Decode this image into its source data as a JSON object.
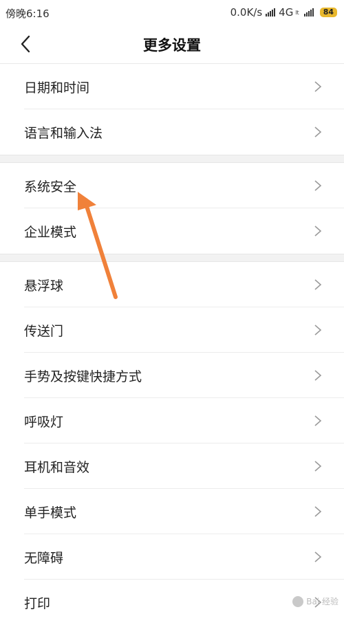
{
  "status_bar": {
    "time": "傍晚6:16",
    "net_speed": "0.0K/s",
    "network": "4G",
    "network_sub": "lt",
    "battery": "84"
  },
  "header": {
    "title": "更多设置"
  },
  "groups": [
    {
      "items": [
        "日期和时间",
        "语言和输入法"
      ]
    },
    {
      "items": [
        "系统安全",
        "企业模式"
      ]
    },
    {
      "items": [
        "悬浮球",
        "传送门",
        "手势及按键快捷方式",
        "呼吸灯",
        "耳机和音效",
        "单手模式",
        "无障碍",
        "打印"
      ]
    }
  ],
  "annotation": {
    "color": "#f0813a",
    "target": "系统安全"
  },
  "watermark": {
    "text": "Bai 经验"
  },
  "colors": {
    "chevron": "#9a9a9a",
    "group_gap": "#f2f2f2"
  }
}
